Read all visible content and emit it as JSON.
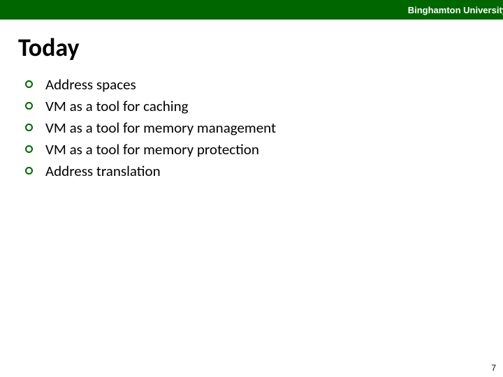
{
  "header": {
    "institution": "Binghamton University"
  },
  "title": "Today",
  "bullets": [
    "Address spaces",
    "VM as a tool for caching",
    "VM as a tool for memory management",
    "VM as a tool for memory protection",
    "Address translation"
  ],
  "page_number": "7"
}
